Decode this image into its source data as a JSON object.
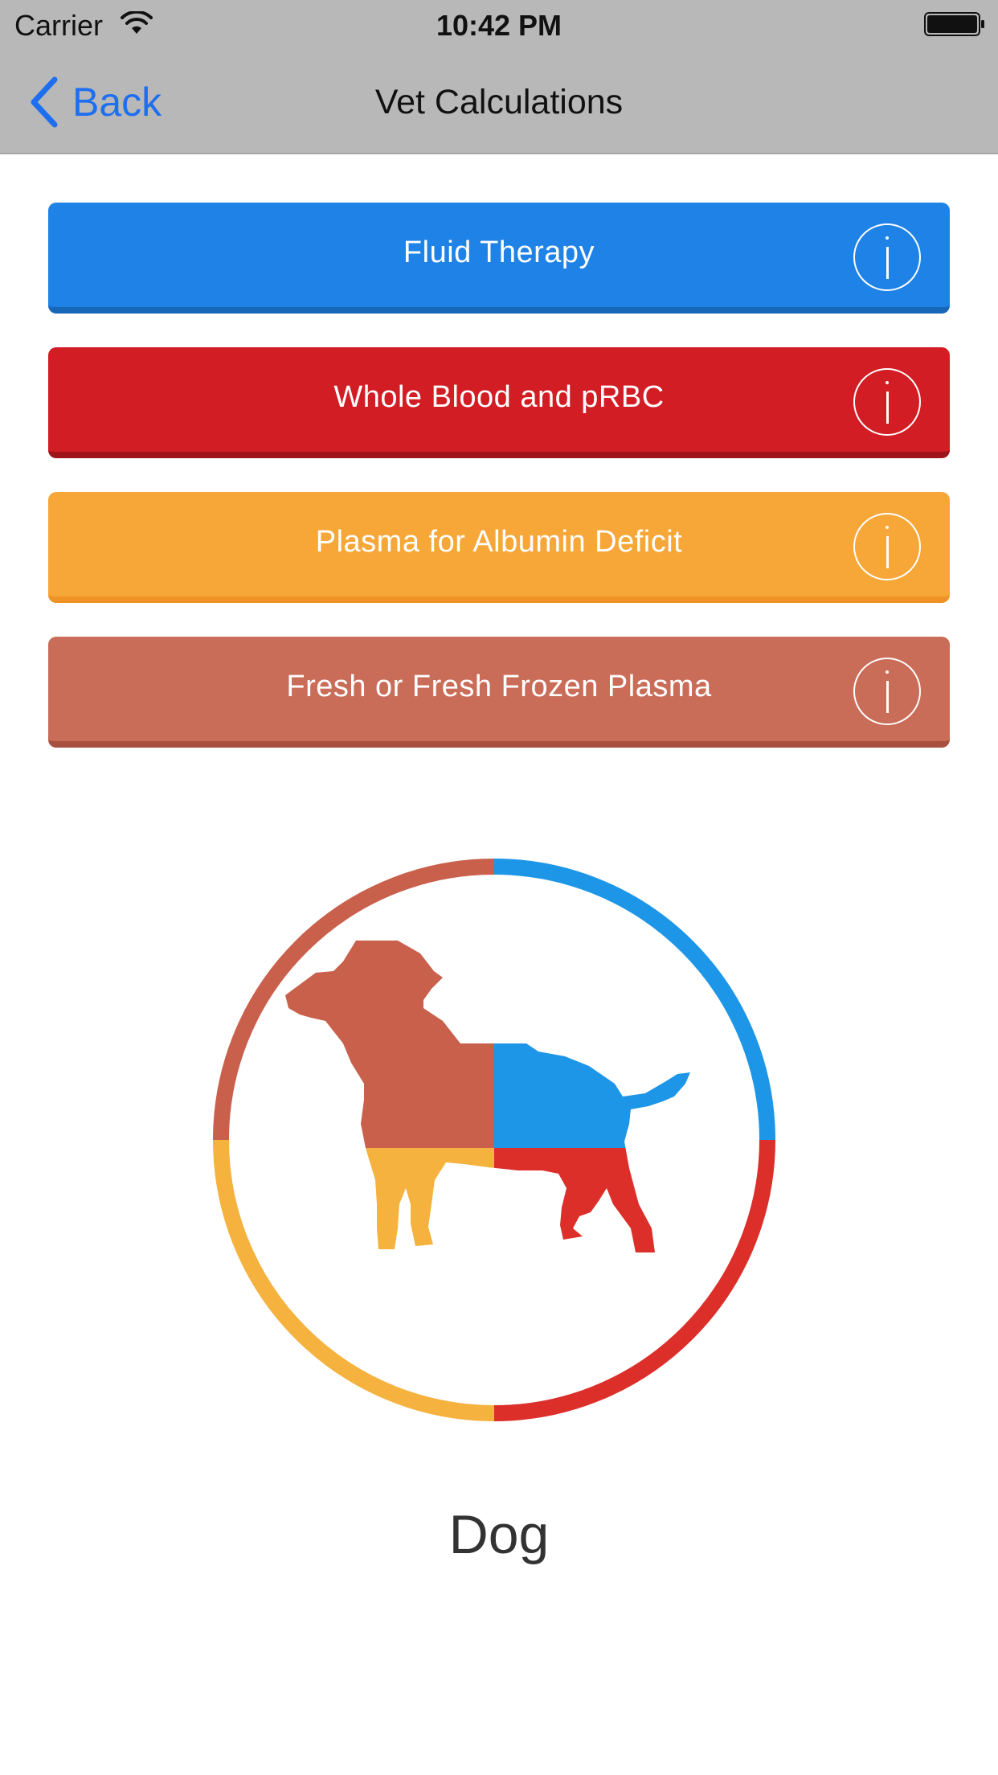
{
  "status_bar": {
    "carrier": "Carrier",
    "time": "10:42 PM",
    "wifi_icon": "wifi-icon",
    "battery_icon": "battery-icon"
  },
  "nav": {
    "back_label": "Back",
    "title": "Vet Calculations",
    "back_icon": "chevron-left-icon"
  },
  "buttons": [
    {
      "label": "Fluid Therapy",
      "color": "#1e82e6",
      "icon": "info-icon"
    },
    {
      "label": "Whole Blood and pRBC",
      "color": "#d21d24",
      "icon": "info-icon"
    },
    {
      "label": "Plasma for Albumin Deficit",
      "color": "#f6a738",
      "icon": "info-icon"
    },
    {
      "label": "Fresh or Fresh Frozen Plasma",
      "color": "#c96c58",
      "icon": "info-icon"
    }
  ],
  "emblem": {
    "icon": "dog-emblem-icon",
    "colors": [
      "#1e82e6",
      "#d21d24",
      "#f6a738",
      "#c96c58"
    ]
  },
  "animal": {
    "label": "Dog"
  }
}
